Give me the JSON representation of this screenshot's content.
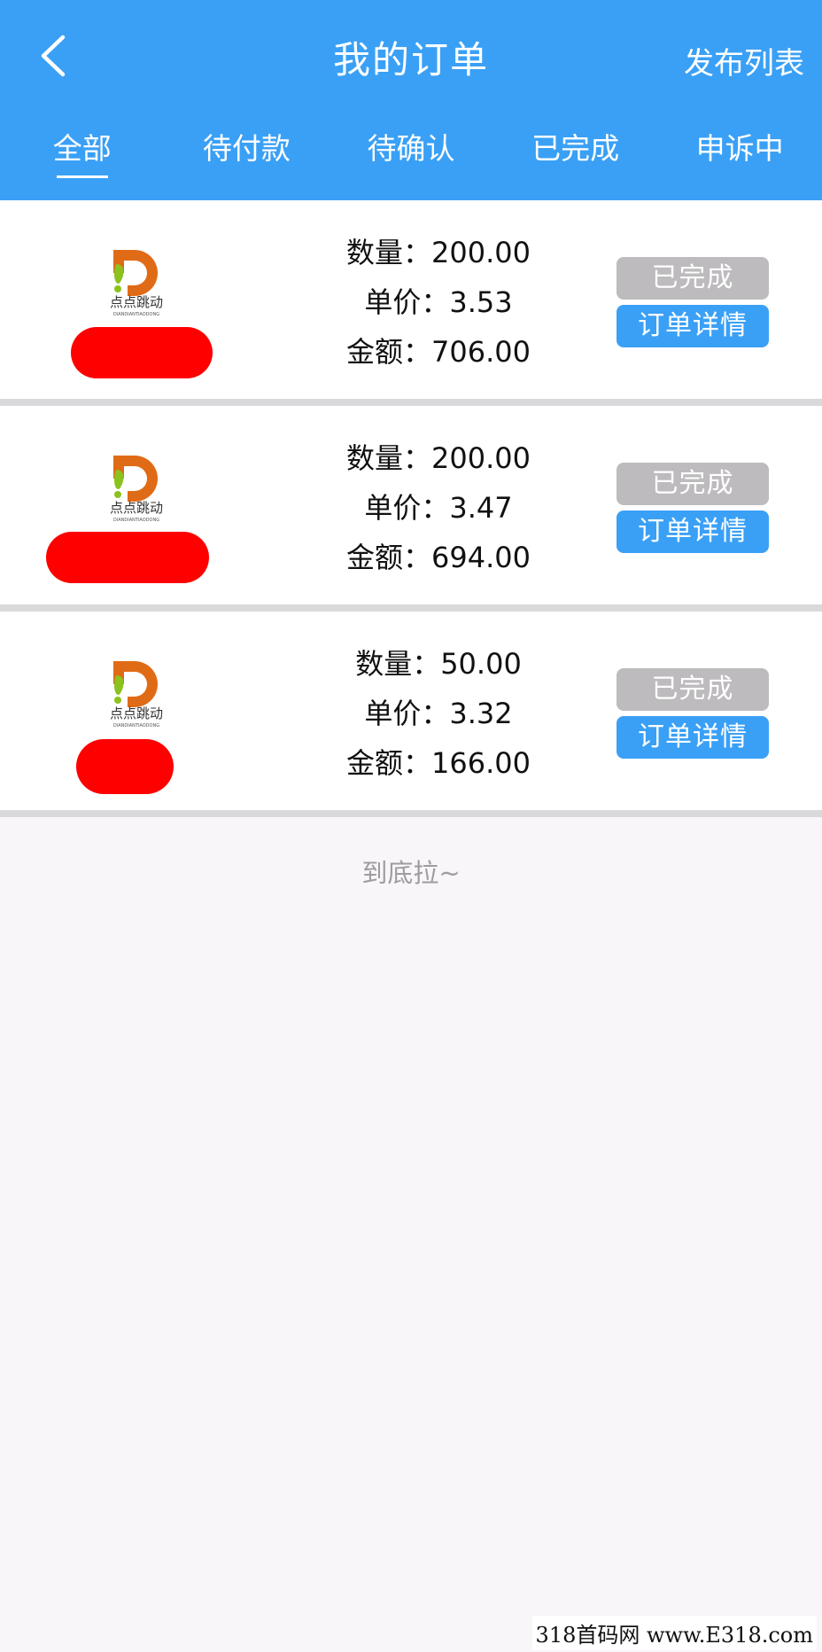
{
  "header": {
    "title": "我的订单",
    "right_action": "发布列表",
    "back_icon": "chevron-left-icon"
  },
  "colors": {
    "primary": "#3aa0f6",
    "status_completed_bg": "#bdbbbd",
    "divider": "#d9d9db",
    "background": "#f8f6f8"
  },
  "tabs": [
    {
      "label": "全部",
      "active": true
    },
    {
      "label": "待付款",
      "active": false
    },
    {
      "label": "待确认",
      "active": false
    },
    {
      "label": "已完成",
      "active": false
    },
    {
      "label": "申诉中",
      "active": false
    }
  ],
  "orders": [
    {
      "logo_text": "点点跳动",
      "logo_subtext": "DIANDIANTIAODONG",
      "quantity": "数量：200.00",
      "unit_price": "单价：3.53",
      "amount": "金额：706.00",
      "status": "已完成",
      "detail_label": "订单详情"
    },
    {
      "logo_text": "点点跳动",
      "logo_subtext": "DIANDIANTIAODONG",
      "quantity": "数量：200.00",
      "unit_price": "单价：3.47",
      "amount": "金额：694.00",
      "status": "已完成",
      "detail_label": "订单详情"
    },
    {
      "logo_text": "点点跳动",
      "logo_subtext": "DIANDIANTIAODONG",
      "quantity": "数量：50.00",
      "unit_price": "单价：3.32",
      "amount": "金额：166.00",
      "status": "已完成",
      "detail_label": "订单详情"
    }
  ],
  "footer": {
    "end_text": "到底拉~"
  },
  "watermark": "318首码网 www.E318.com"
}
